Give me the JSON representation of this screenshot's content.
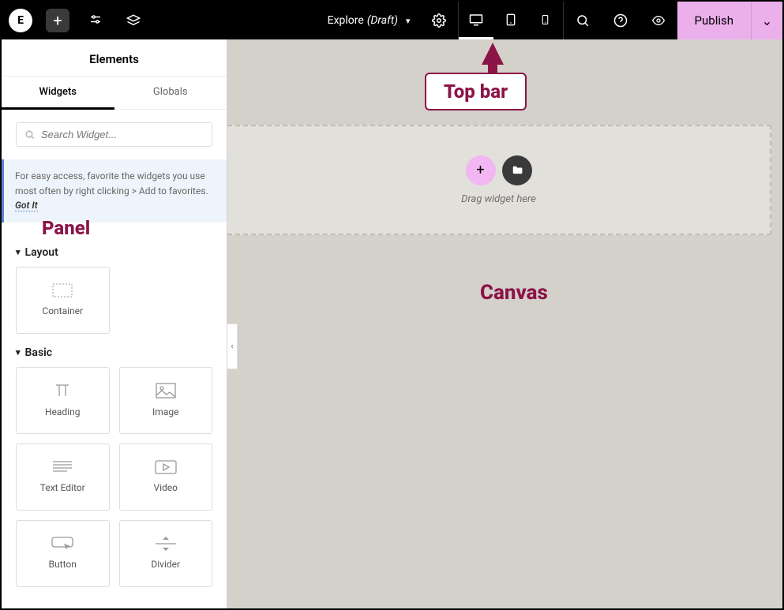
{
  "topbar": {
    "logo_letter": "E",
    "doc_name": "Explore",
    "doc_status": "(Draft)",
    "publish_label": "Publish"
  },
  "panel": {
    "title": "Elements",
    "tabs": {
      "widgets": "Widgets",
      "globals": "Globals"
    },
    "search_placeholder": "Search Widget...",
    "tip_text": "For easy access, favorite the widgets you use most often by right clicking > Add to favorites. ",
    "tip_action": "Got It",
    "sections": {
      "layout": {
        "label": "Layout",
        "items": [
          {
            "label": "Container"
          }
        ]
      },
      "basic": {
        "label": "Basic",
        "items": [
          {
            "label": "Heading"
          },
          {
            "label": "Image"
          },
          {
            "label": "Text Editor"
          },
          {
            "label": "Video"
          },
          {
            "label": "Button"
          },
          {
            "label": "Divider"
          }
        ]
      }
    }
  },
  "canvas": {
    "drop_label": "Drag widget here"
  },
  "annotations": {
    "topbar": "Top bar",
    "panel": "Panel",
    "canvas": "Canvas"
  }
}
